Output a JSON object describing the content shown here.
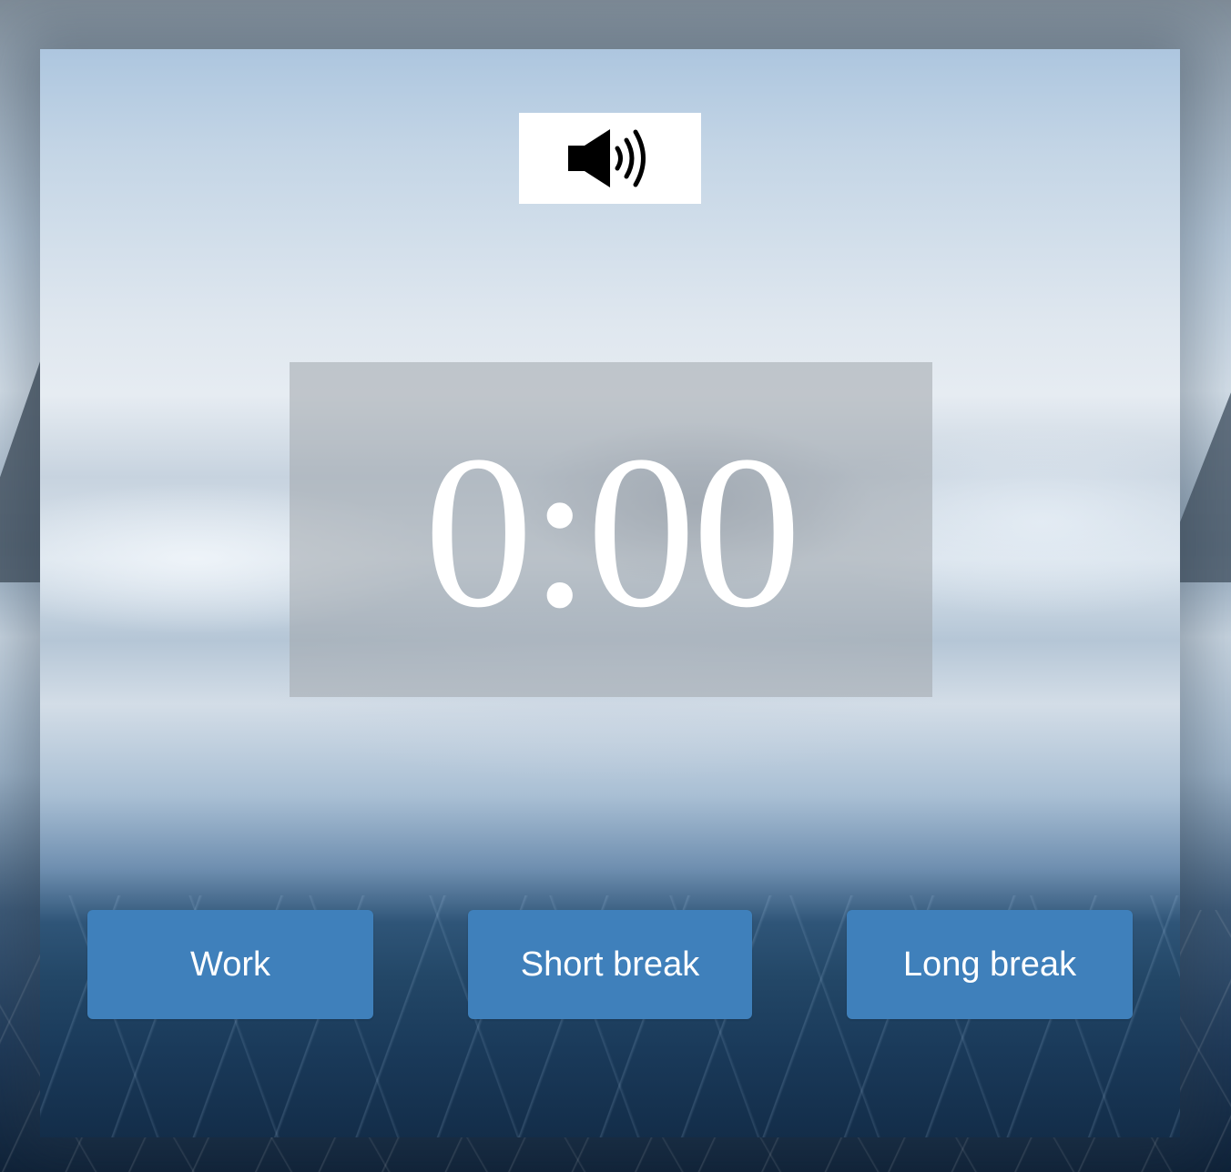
{
  "sound_toggle": {
    "icon": "speaker-volume-icon"
  },
  "timer": {
    "display": "0:00"
  },
  "modes": [
    {
      "label": "Work"
    },
    {
      "label": "Short break"
    },
    {
      "label": "Long break"
    }
  ],
  "colors": {
    "button_bg": "#3f80bb",
    "button_text": "#ffffff",
    "timer_text": "#ffffff",
    "sound_button_bg": "#ffffff"
  }
}
